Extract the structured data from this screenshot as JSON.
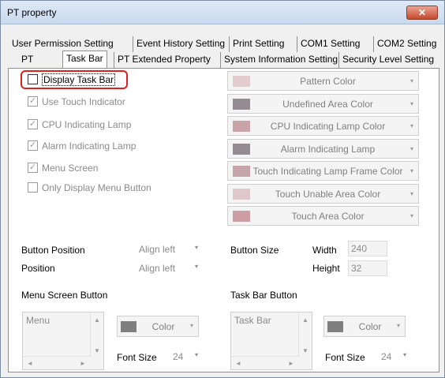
{
  "window": {
    "title": "PT property",
    "close_glyph": "✕"
  },
  "tabs_row1": [
    "User Permission Setting",
    "Event History Setting",
    "Print Setting",
    "COM1 Setting",
    "COM2 Setting"
  ],
  "tabs_row2": [
    "PT",
    "Task Bar",
    "PT Extended Property",
    "System Information Setting",
    "Security Level Setting"
  ],
  "active_tab": "Task Bar",
  "checkboxes": [
    {
      "label": "Display Task Bar",
      "checked": false,
      "enabled": true
    },
    {
      "label": "Use Touch Indicator",
      "checked": true,
      "enabled": false
    },
    {
      "label": "CPU Indicating Lamp",
      "checked": true,
      "enabled": false
    },
    {
      "label": "Alarm Indicating Lamp",
      "checked": true,
      "enabled": false
    },
    {
      "label": "Menu Screen",
      "checked": true,
      "enabled": false
    },
    {
      "label": "Only Display Menu Button",
      "checked": false,
      "enabled": false
    }
  ],
  "color_buttons": [
    {
      "label": "Pattern Color",
      "swatch": "#e2cccd"
    },
    {
      "label": "Undefined Area Color",
      "swatch": "#958c93"
    },
    {
      "label": "CPU Indicating Lamp Color",
      "swatch": "#caa3a8"
    },
    {
      "label": "Alarm Indicating Lamp",
      "swatch": "#958c93"
    },
    {
      "label": "Touch Indicating Lamp Frame Color",
      "swatch": "#c5a5aa"
    },
    {
      "label": "Touch Unable Area Color",
      "swatch": "#dfc8cb"
    },
    {
      "label": "Touch Area Color",
      "swatch": "#cc9ea3"
    }
  ],
  "button_position": {
    "label": "Button Position",
    "value": "Align left"
  },
  "position": {
    "label": "Position",
    "value": "Align left"
  },
  "button_size": {
    "label": "Button Size",
    "width_label": "Width",
    "width": "240",
    "height_label": "Height",
    "height": "32"
  },
  "menu_screen_button": {
    "heading": "Menu Screen Button",
    "list_text": "Menu",
    "color_label": "Color",
    "font_size_label": "Font Size",
    "font_size": "24"
  },
  "task_bar_button": {
    "heading": "Task Bar Button",
    "list_text": "Task Bar",
    "color_label": "Color",
    "font_size_label": "Font Size",
    "font_size": "24"
  },
  "icons": {
    "dropdown": "▾",
    "check": "✓",
    "up": "▲",
    "down": "▼",
    "left": "◄",
    "right": "►"
  }
}
